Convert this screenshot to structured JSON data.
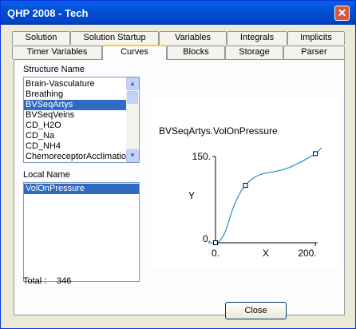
{
  "window": {
    "title": "QHP 2008 - Tech",
    "close_glyph": "✕"
  },
  "tabs_row1": [
    "Solution",
    "Solution Startup",
    "Variables",
    "Integrals",
    "Implicits"
  ],
  "tabs_row2": [
    "Timer Variables",
    "Curves",
    "Blocks",
    "Storage",
    "Parser"
  ],
  "active_tab": "Curves",
  "structure": {
    "label": "Structure Name",
    "items": [
      "Brain-Vasculature",
      "Breathing",
      "BVSeqArtys",
      "BVSeqVeins",
      "CD_H2O",
      "CD_Na",
      "CD_NH4",
      "ChemoreceptorAcclimatio"
    ],
    "selected": "BVSeqArtys"
  },
  "local": {
    "label": "Local Name",
    "items": [
      "VolOnPressure"
    ],
    "selected": "VolOnPressure"
  },
  "total": {
    "label": "Total :",
    "value": "346"
  },
  "close_button": "Close",
  "chart_data": {
    "type": "line",
    "title": "BVSeqArtys.VolOnPressure",
    "xlabel": "X",
    "ylabel": "Y",
    "xticks": [
      "0.",
      "200."
    ],
    "yticks": [
      "150.",
      "0."
    ],
    "xlim": [
      0,
      200
    ],
    "ylim": [
      0,
      150
    ],
    "points": [
      [
        0,
        0
      ],
      [
        60,
        100
      ],
      [
        200,
        155
      ]
    ],
    "curve": [
      [
        -15,
        0
      ],
      [
        0,
        0
      ],
      [
        8,
        3
      ],
      [
        20,
        20
      ],
      [
        35,
        60
      ],
      [
        50,
        88
      ],
      [
        60,
        100
      ],
      [
        75,
        112
      ],
      [
        95,
        120
      ],
      [
        120,
        124
      ],
      [
        145,
        130
      ],
      [
        170,
        140
      ],
      [
        200,
        155
      ],
      [
        212,
        165
      ]
    ],
    "grid": false,
    "line_color": "#1c8ed8"
  }
}
